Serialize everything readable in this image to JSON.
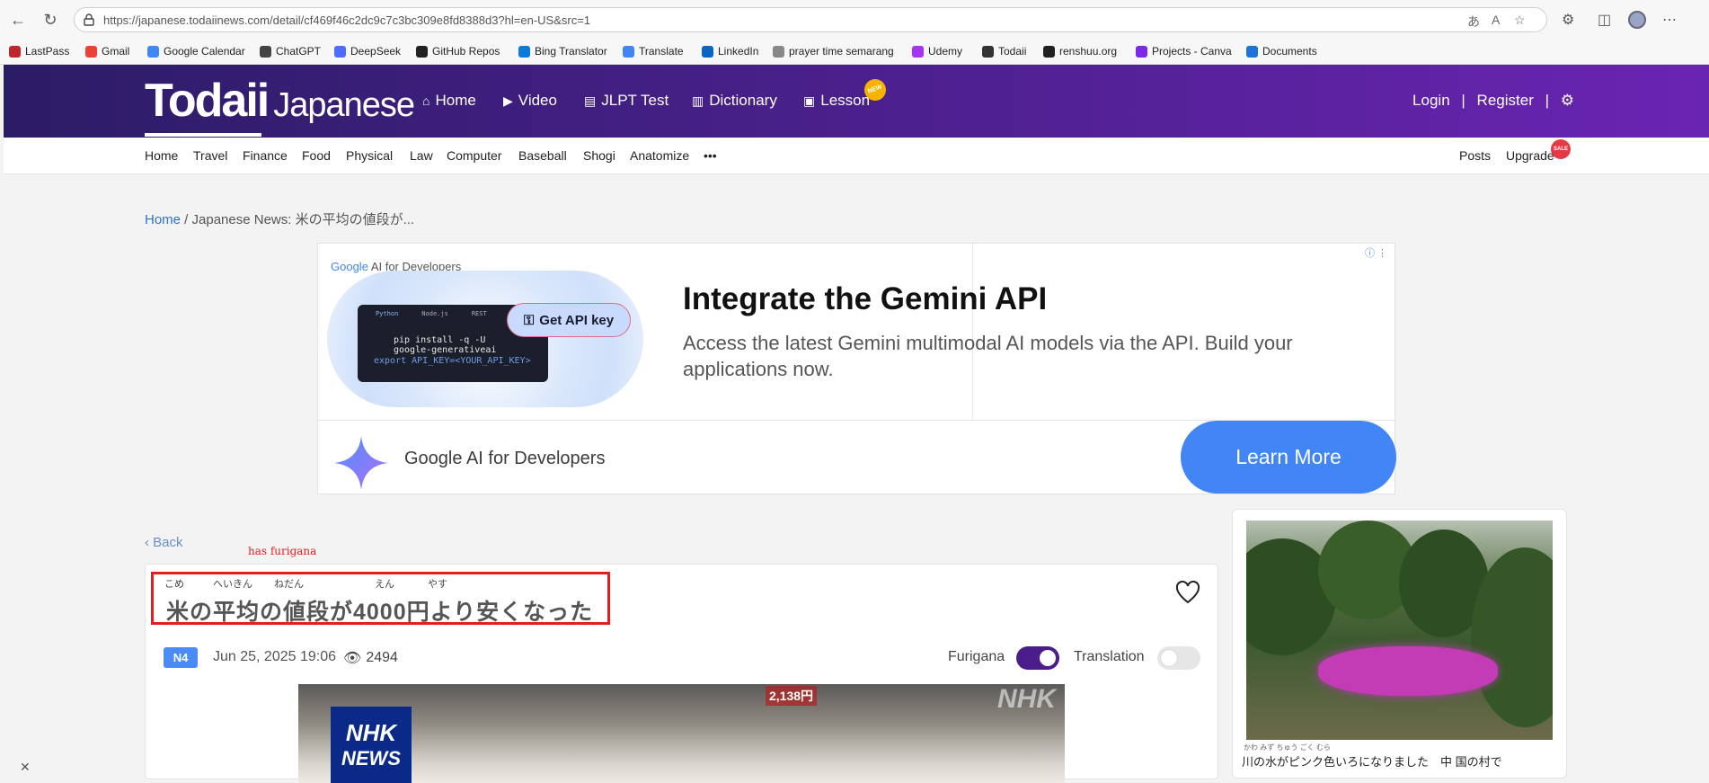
{
  "browser": {
    "url": "https://japanese.todaiinews.com/detail/cf469f46c2dc9c7c3bc309e8fd8388d3?hl=en-US&src=1",
    "bookmarks": [
      "LastPass",
      "Gmail",
      "Google Calendar",
      "ChatGPT",
      "DeepSeek",
      "GitHub Repos",
      "Bing Translator",
      "Translate",
      "LinkedIn",
      "prayer time semarang",
      "Udemy",
      "Todaii",
      "renshuu.org",
      "Projects - Canva",
      "Documents"
    ],
    "bookmark_colors": [
      "#c0262d",
      "#ea4335",
      "#4285f4",
      "#444444",
      "#4d6bfe",
      "#222222",
      "#0a7bd6",
      "#4285f4",
      "#0a66c2",
      "#888888",
      "#a435f0",
      "#333333",
      "#222222",
      "#7d2ae8",
      "#1e73d8"
    ]
  },
  "site": {
    "logo_main": "Todaii",
    "logo_sub": "Japanese",
    "nav": [
      "Home",
      "Video",
      "JLPT Test",
      "Dictionary",
      "Lesson"
    ],
    "nav_icons": [
      "home-icon",
      "play-icon",
      "test-icon",
      "book-icon",
      "lesson-icon"
    ],
    "new_badge": "NEW",
    "login": "Login",
    "separator": "|",
    "register": "Register",
    "categories": [
      "Home",
      "Travel",
      "Finance",
      "Food",
      "Physical",
      "Law",
      "Computer",
      "Baseball",
      "Shogi",
      "Anatomize",
      "•••"
    ],
    "posts": "Posts",
    "upgrade": "Upgrade",
    "sale_badge": "SALE",
    "header_gradient": [
      "#2b1c66",
      "#6a24b2"
    ]
  },
  "breadcrumb": {
    "home": "Home",
    "rest": " / Japanese News: 米の平均の値段が..."
  },
  "ad": {
    "brand_small_google": "Google",
    "brand_small_rest": " AI for Developers",
    "code_tabs": [
      "Python",
      "Node.js",
      "REST"
    ],
    "code_lines": [
      "pip install -q -U",
      "google-generativeai",
      "export API_KEY=<YOUR_API_KEY>"
    ],
    "api_button": "Get API key",
    "headline": "Integrate the Gemini API",
    "description": "Access the latest Gemini multimodal AI models via the API. Build your applications now.",
    "brand": "Google AI for Developers",
    "cta": "Learn More",
    "cta_color": "#4285f4"
  },
  "article": {
    "back": "Back",
    "annotation": "has furigana",
    "title": "米の平均の値段が4000円より安くなった",
    "ruby": [
      "こめ",
      "へいきん",
      "ねだん",
      "えん",
      "やす"
    ],
    "level": "N4",
    "date": "Jun 25, 2025 19:06",
    "views": "2494",
    "furigana_label": "Furigana",
    "furigana_on": true,
    "translation_label": "Translation",
    "translation_on": false,
    "image_logo_top": "NHK",
    "image_logo_bottom": "NEWS",
    "image_watermark": "NHK",
    "image_price": "2,138円"
  },
  "sidebar": {
    "caption_ruby": "かわ みず                                        ちゅう ごく  むら",
    "caption": "川の水がピンク色いろになりました　中 国の村で"
  }
}
